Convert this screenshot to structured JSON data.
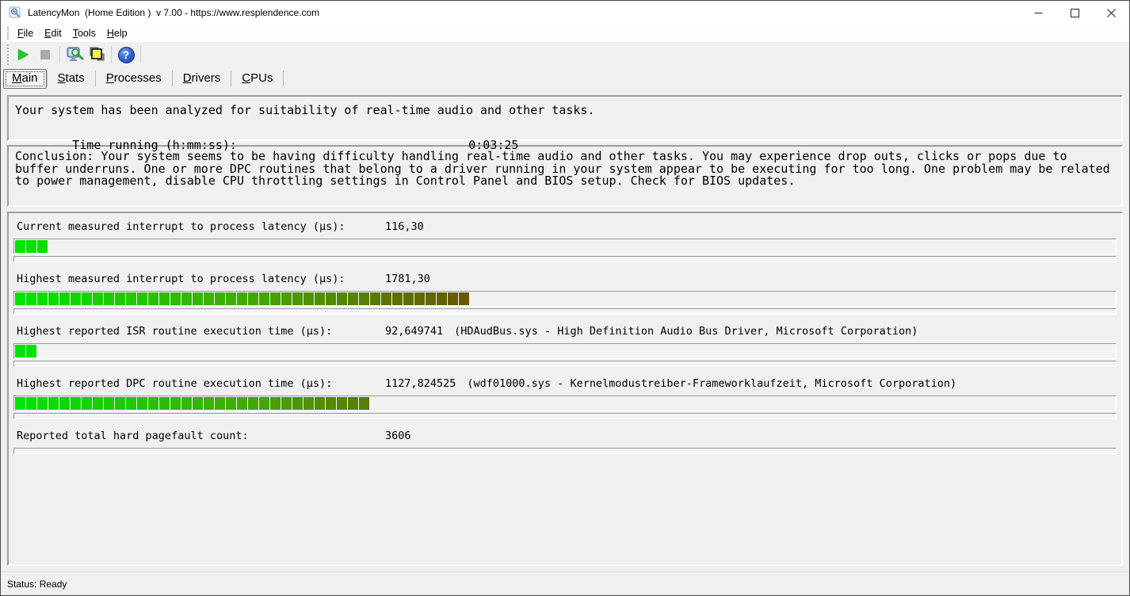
{
  "window": {
    "title": "LatencyMon  (Home Edition )  v 7.00 - https://www.resplendence.com"
  },
  "menu": {
    "items": [
      {
        "name": "file",
        "accel": "F",
        "rest": "ile"
      },
      {
        "name": "edit",
        "accel": "E",
        "rest": "dit"
      },
      {
        "name": "tools",
        "accel": "T",
        "rest": "ools"
      },
      {
        "name": "help",
        "accel": "H",
        "rest": "elp"
      }
    ]
  },
  "toolbar": {
    "buttons": [
      "play",
      "stop",
      "analyze-monitor",
      "copy-report",
      "help"
    ]
  },
  "tabs": {
    "items": [
      {
        "name": "main",
        "accel": "M",
        "rest": "ain",
        "active": true
      },
      {
        "name": "stats",
        "accel": "S",
        "rest": "tats",
        "active": false
      },
      {
        "name": "processes",
        "accel": "P",
        "rest": "rocesses",
        "active": false
      },
      {
        "name": "drivers",
        "accel": "D",
        "rest": "rivers",
        "active": false
      },
      {
        "name": "cpus",
        "accel": "C",
        "rest": "PUs",
        "active": false
      }
    ]
  },
  "analysis_box": {
    "line1": "Your system has been analyzed for suitability of real-time audio and other tasks.",
    "time_label": "Time running (h:mm:ss):",
    "time_value": "0:03:25"
  },
  "conclusion_box": {
    "text": "Conclusion: Your system seems to be having difficulty handling real-time audio and other tasks. You may experience drop outs, clicks or pops due to buffer underruns. One or more DPC routines that belong to a driver running in your system appear to be executing for too long. One problem may be related to power management, disable CPU throttling settings in Control Panel and BIOS setup. Check for BIOS updates."
  },
  "measurements": {
    "bar_total_segments": 99,
    "bar_gradient": {
      "start": "#00e400",
      "mid": "#44a800",
      "end": "#6b5200"
    },
    "rows": [
      {
        "label": "Current measured interrupt to process latency (µs):",
        "value": "116,30",
        "note": "",
        "thick_bar": true,
        "bar_segments": 3
      },
      {
        "label": "Highest measured interrupt to process latency (µs):",
        "value": "1781,30",
        "note": "",
        "thick_bar": true,
        "bar_segments": 41
      },
      {
        "label": "Highest reported ISR routine execution time (µs):",
        "value": "92,649741",
        "note": "(HDAudBus.sys - High Definition Audio Bus Driver, Microsoft Corporation)",
        "thick_bar": true,
        "bar_segments": 2
      },
      {
        "label": "Highest reported DPC routine execution time (µs):",
        "value": "1127,824525",
        "note": "(wdf01000.sys - Kernelmodustreiber-Frameworklaufzeit, Microsoft Corporation)",
        "thick_bar": true,
        "bar_segments": 32
      },
      {
        "label": "Reported total hard pagefault count:",
        "value": "3606",
        "note": "",
        "thick_bar": false,
        "bar_segments": 0
      }
    ]
  },
  "status_bar": {
    "text": "Status: Ready"
  }
}
